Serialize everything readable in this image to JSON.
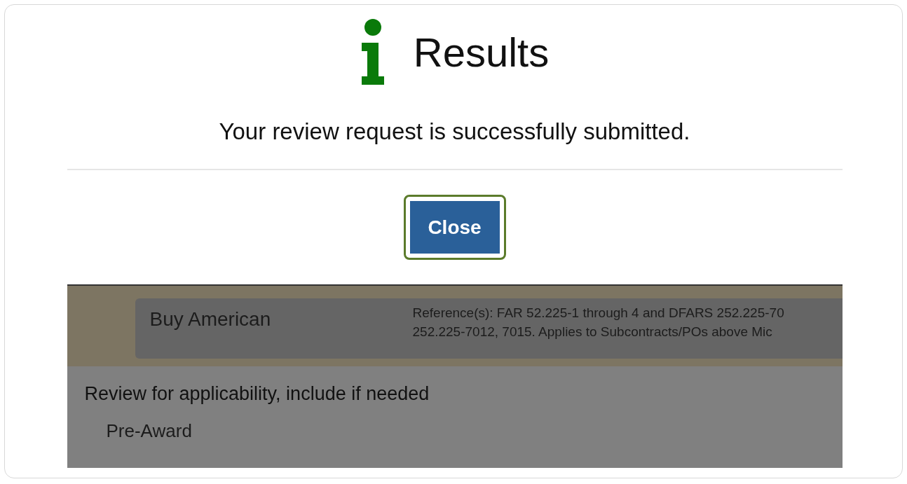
{
  "dialog": {
    "title": "Results",
    "message": "Your review request is successfully submitted.",
    "button": {
      "label": "Close",
      "focused": true
    }
  },
  "background_page": {
    "clause": {
      "name": "Buy American",
      "reference_lines": [
        "Reference(s): FAR 52.225-1 through 4 and DFARS 252.225-70",
        "252.225-7012, 7015. Applies to Subcontracts/POs above Mic"
      ]
    },
    "section_heading": "Review for applicability, include if needed",
    "subsection": "Pre-Award"
  }
}
